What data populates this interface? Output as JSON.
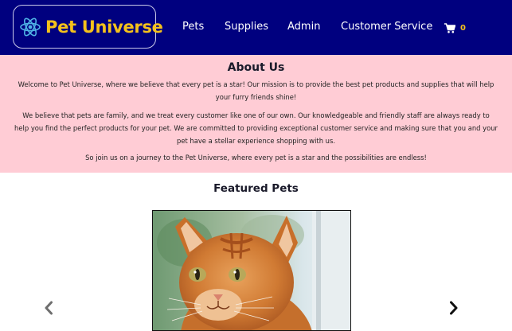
{
  "navbar": {
    "brand": {
      "name": "Pet Universe",
      "icon": "react-atom-icon"
    },
    "links": [
      {
        "label": "Pets"
      },
      {
        "label": "Supplies"
      },
      {
        "label": "Admin"
      },
      {
        "label": "Customer Service"
      }
    ],
    "cart": {
      "icon": "shopping-cart-icon",
      "count": "0"
    },
    "colors": {
      "background": "#00007f",
      "brand_text": "#f5c21b",
      "link_text": "#ffffff"
    }
  },
  "about": {
    "title": "About Us",
    "paragraphs": [
      "Welcome to Pet Universe, where we believe that every pet is a star! Our mission is to provide the best pet products and supplies that will help your furry friends shine!",
      "We believe that pets are family, and we treat every customer like one of our own. Our knowledgeable and friendly staff are always ready to help you find the perfect products for your pet. We are committed to providing exceptional customer service and making sure that you and your pet have a stellar experience shopping with us.",
      "So join us on a journey to the Pet Universe, where every pet is a star and the possibilities are endless!"
    ],
    "colors": {
      "background": "#ffccd5"
    }
  },
  "featured": {
    "title": "Featured Pets",
    "carousel": {
      "image": "orange-tabby-cat",
      "prev_icon": "chevron-left-icon",
      "next_icon": "chevron-right-icon"
    }
  }
}
